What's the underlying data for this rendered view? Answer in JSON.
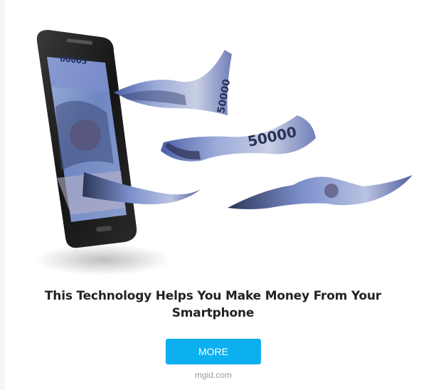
{
  "ad": {
    "headline": "This Technology Helps You Make Money From Your Smartphone",
    "cta_label": "MORE",
    "source": "mgid.com",
    "image": {
      "icon": "phone-money-illustration",
      "banknote_value": "50000",
      "phone_screen_note_text": "00005"
    }
  },
  "colors": {
    "cta_background": "#0cb0ee",
    "headline_text": "#222222",
    "source_text": "#9a9a9a",
    "side_stripe": "#f3f8f3"
  }
}
